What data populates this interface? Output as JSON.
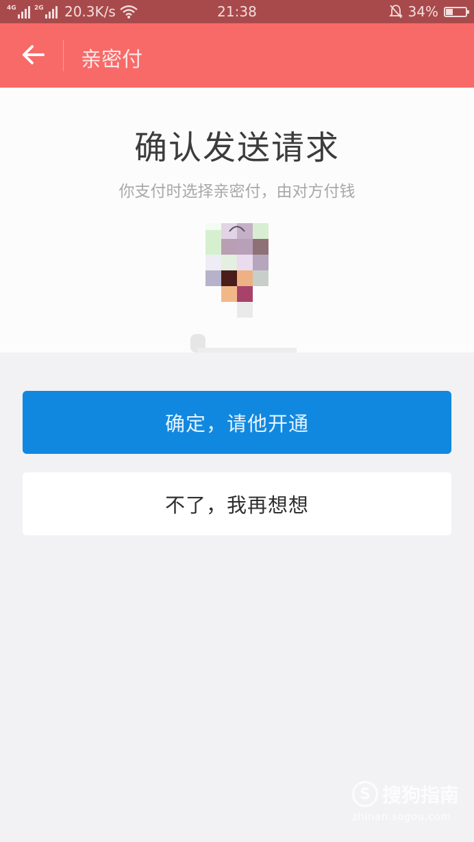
{
  "status_bar": {
    "net1": "4G",
    "net2": "2G",
    "speed": "20.3K/s",
    "time": "21:38",
    "battery": "34%",
    "battery_level": 0.34
  },
  "app_bar": {
    "title": "亲密付"
  },
  "confirm": {
    "title": "确认发送请求",
    "subtitle": "你支付时选择亲密付，由对方付钱"
  },
  "buttons": {
    "confirm": "确定，请他开通",
    "cancel": "不了，我再想想"
  },
  "watermark": {
    "brand": "搜狗指南",
    "url": "zhinan.sogou.com"
  },
  "colors": {
    "app_bar": "#f76a68",
    "status_bar": "#a84a4c",
    "primary_button": "#1188e0",
    "background": "#f2f1f4"
  }
}
